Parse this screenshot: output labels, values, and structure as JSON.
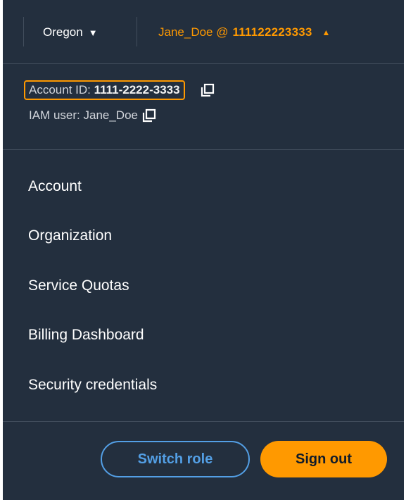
{
  "header": {
    "region": "Oregon",
    "user": "Jane_Doe @",
    "account_number": "111122223333"
  },
  "account": {
    "id_label": "Account ID:",
    "id_value": "1111-2222-3333",
    "iam_label": "IAM user:",
    "iam_value": "Jane_Doe"
  },
  "menu": {
    "items": [
      {
        "label": "Account"
      },
      {
        "label": "Organization"
      },
      {
        "label": "Service Quotas"
      },
      {
        "label": "Billing Dashboard"
      },
      {
        "label": "Security credentials"
      }
    ]
  },
  "actions": {
    "switch_role": "Switch role",
    "sign_out": "Sign out"
  },
  "icons": {
    "region_caret": "caret-down-icon",
    "account_caret": "caret-up-icon",
    "copy": "copy-icon"
  },
  "colors": {
    "background": "#232f3e",
    "accent": "#ff9900",
    "link": "#539fe5",
    "divider": "#414d5c"
  }
}
